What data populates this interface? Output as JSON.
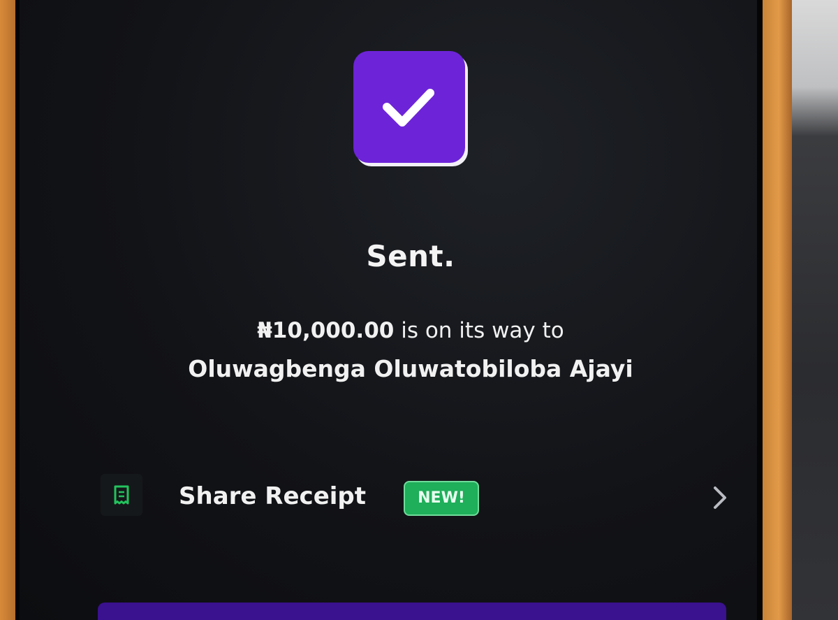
{
  "status": {
    "title": "Sent.",
    "amount": "₦10,000.00",
    "message_suffix": " is on its way to",
    "recipient": "Oluwagbenga Oluwatobiloba Ajayi"
  },
  "actions": {
    "share_receipt_label": "Share Receipt",
    "new_badge": "NEW!"
  },
  "colors": {
    "accent": "#6d24d8",
    "badge": "#1fae5a",
    "screen_bg": "#121317"
  },
  "icons": {
    "success": "checkmark-icon",
    "receipt": "receipt-icon",
    "chevron": "chevron-right-icon"
  }
}
